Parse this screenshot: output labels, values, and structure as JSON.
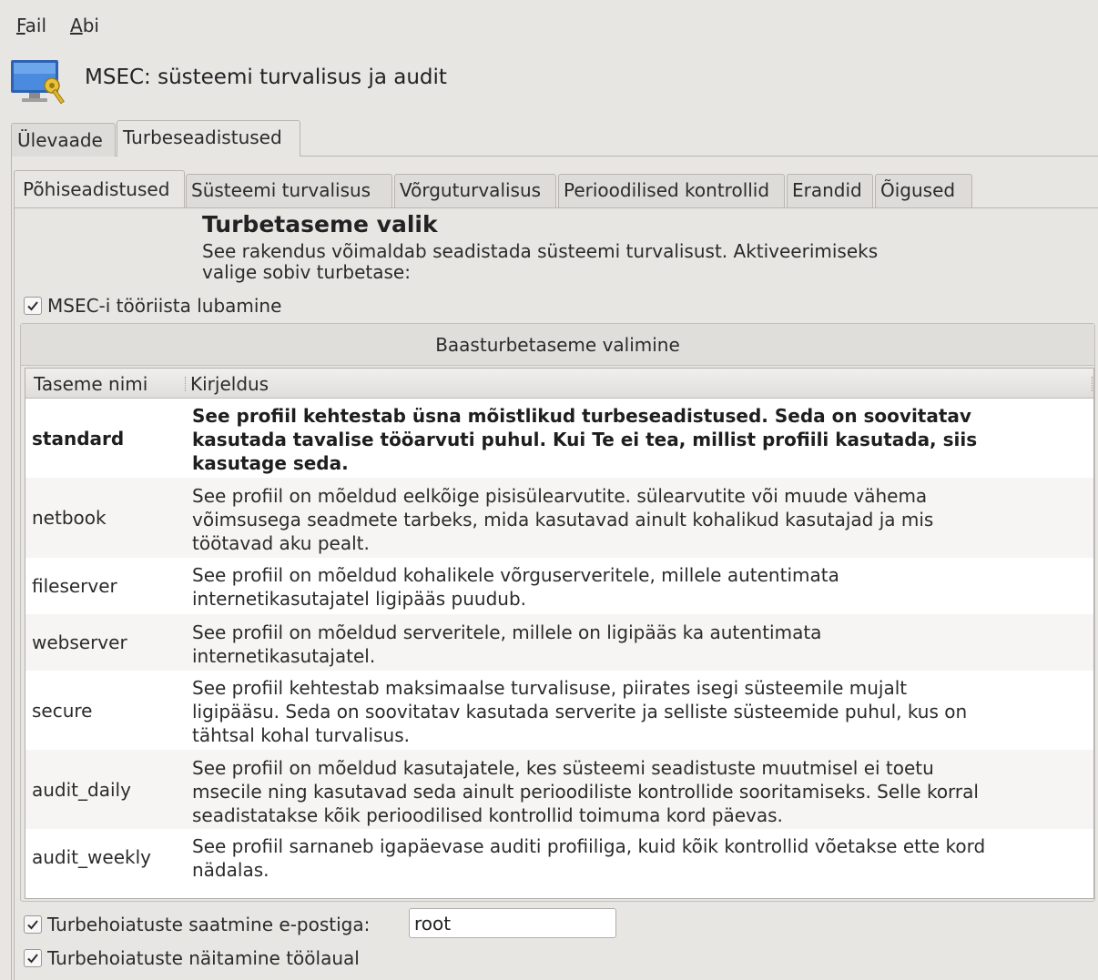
{
  "menubar": {
    "items": [
      {
        "accel": "F",
        "rest": "ail"
      },
      {
        "accel": "A",
        "rest": "bi"
      }
    ]
  },
  "app": {
    "title": "MSEC: süsteemi turvalisus ja audit",
    "icon": "monitor-key-icon"
  },
  "outer_tabs": [
    "Ülevaade",
    "Turbeseadistused"
  ],
  "outer_active": 1,
  "inner_tabs": [
    "Põhiseadistused",
    "Süsteemi turvalisus",
    "Võrguturvalisus",
    "Perioodilised kontrollid",
    "Erandid",
    "Õigused"
  ],
  "inner_active": 0,
  "section": {
    "title": "Turbetaseme valik",
    "description": "See rakendus võimaldab seadistada süsteemi turvalisust. Aktiveerimiseks valige sobiv turbetase:"
  },
  "enable_msec": {
    "label": "MSEC-i tööriista lubamine",
    "checked": true
  },
  "levels": {
    "group_title": "Baasturbetaseme valimine",
    "columns": [
      "Taseme nimi",
      "Kirjeldus"
    ],
    "rows": [
      {
        "name": "standard",
        "description": "See profiil kehtestab üsna mõistlikud turbeseadistused. Seda on soovitatav kasutada tavalise tööarvuti puhul. Kui Te ei tea, millist profiili kasutada, siis kasutage seda.",
        "selected": true
      },
      {
        "name": "netbook",
        "description": "See profiil on mõeldud eelkõige pisisülearvutite. sülearvutite või muude vähema võimsusega seadmete tarbeks, mida kasutavad ainult kohalikud kasutajad ja mis töötavad aku pealt."
      },
      {
        "name": "fileserver",
        "description": "See profiil on mõeldud kohalikele võrguserveritele, millele autentimata internetikasutajatel ligipääs puudub."
      },
      {
        "name": "webserver",
        "description": "See profiil on mõeldud serveritele, millele on ligipääs ka autentimata internetikasutajatel."
      },
      {
        "name": "secure",
        "description": "See profiil kehtestab maksimaalse turvalisuse, piirates isegi süsteemile mujalt ligipääsu. Seda on soovitatav kasutada serverite ja selliste süsteemide puhul, kus on tähtsal kohal turvalisus."
      },
      {
        "name": "audit_daily",
        "description": "See profiil on mõeldud kasutajatele, kes süsteemi seadistuste muutmisel ei toetu msecile ning kasutavad seda ainult perioodiliste kontrollide sooritamiseks. Selle korral seadistatakse kõik perioodilised kontrollid toimuma kord päevas."
      },
      {
        "name": "audit_weekly",
        "description": "See profiil sarnaneb igapäevase auditi profiiliga, kuid kõik kontrollid võetakse ette kord nädalas."
      }
    ]
  },
  "email_alerts": {
    "label": "Turbehoiatuste saatmine e-postiga:",
    "checked": true,
    "value": "root"
  },
  "desktop_alerts": {
    "label": "Turbehoiatuste näitamine töölaual",
    "checked": true
  },
  "colors": {
    "window_bg": "#e8e6e3",
    "table_bg": "#ffffff",
    "alt_row": "#f6f5f4"
  }
}
